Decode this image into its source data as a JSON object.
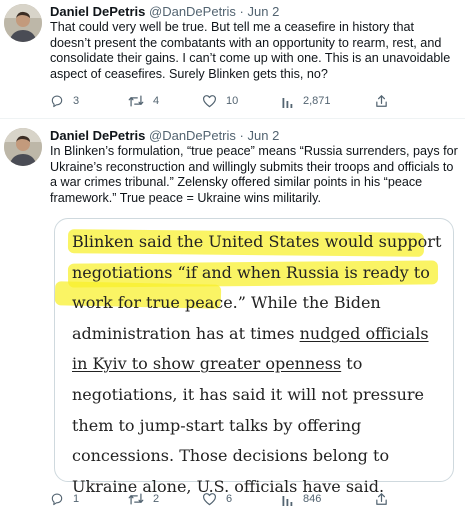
{
  "tweets": [
    {
      "author_name": "Daniel DePetris",
      "handle": "@DanDePetris",
      "date": "Jun 2",
      "text": "That could very well be true. But tell me a ceasefire in history that doesn’t present the combatants with an opportunity to rearm, rest, and consolidate their gains. I can’t come up with one. This is an unavoidable aspect of ceasefires. Surely Blinken gets this, no?",
      "replies": "3",
      "retweets": "4",
      "likes": "10",
      "views": "2,871",
      "icons": [
        "reply-icon",
        "retweet-icon",
        "like-icon",
        "views-icon",
        "share-icon"
      ]
    },
    {
      "author_name": "Daniel DePetris",
      "handle": "@DanDePetris",
      "date": "Jun 2",
      "text": "In Blinken’s formulation, “true peace” means “Russia surrenders, pays for Ukraine’s reconstruction and willingly submits their troops and officials to a war crimes tribunal.” Zelensky offered similar points in his “peace framework.” True peace = Ukraine wins militarily.",
      "quote": {
        "part1": "Blinken said the United States would support negotiations “if and when Russia is ready to work for true peace.” While the Biden administration has at times ",
        "link": "nudged officials in Kyiv to show greater openness",
        "part2": " to negotiations, it has said it will not pressure them to jump-start talks by offering concessions. Those decisions belong to Ukraine alone, U.S. officials have said.",
        "highlight_color": "#f8f028"
      },
      "replies": "1",
      "retweets": "2",
      "likes": "6",
      "views": "846",
      "icons": [
        "reply-icon",
        "retweet-icon",
        "like-icon",
        "views-icon",
        "share-icon"
      ]
    }
  ],
  "colors": {
    "text": "#0f1419",
    "secondary": "#536471",
    "border": "#cfd9de"
  }
}
